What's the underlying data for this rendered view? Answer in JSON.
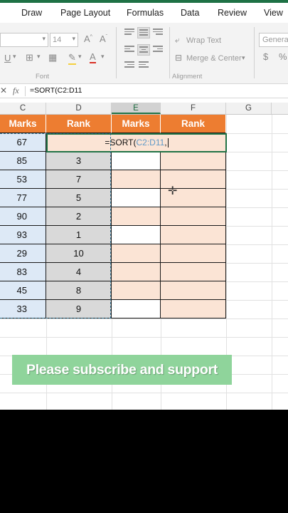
{
  "menu": [
    "Draw",
    "Page Layout",
    "Formulas",
    "Data",
    "Review",
    "View"
  ],
  "ribbon": {
    "font_size": "14",
    "wrap_text": "Wrap Text",
    "merge_center": "Merge & Center",
    "number_format": "General",
    "font_group": "Font",
    "alignment_group": "Alignment",
    "currency_symbol": "$",
    "percent_symbol": "%"
  },
  "formula_bar": {
    "fx": "fx",
    "content": "=SORT(C2:D11"
  },
  "columns": [
    "C",
    "D",
    "E",
    "F",
    "G"
  ],
  "headers": {
    "c": "Marks",
    "d": "Rank",
    "e": "Marks",
    "f": "Rank"
  },
  "rows": [
    {
      "marks": "67",
      "rank": ""
    },
    {
      "marks": "85",
      "rank": "3"
    },
    {
      "marks": "53",
      "rank": "7"
    },
    {
      "marks": "77",
      "rank": "5"
    },
    {
      "marks": "90",
      "rank": "2"
    },
    {
      "marks": "93",
      "rank": "1"
    },
    {
      "marks": "29",
      "rank": "10"
    },
    {
      "marks": "83",
      "rank": "4"
    },
    {
      "marks": "45",
      "rank": "8"
    },
    {
      "marks": "33",
      "rank": "9"
    }
  ],
  "edit_cell": {
    "prefix": "=SORT(",
    "ref": "C2:D11",
    "suffix": ","
  },
  "banner": "Please subscribe and support",
  "colors": {
    "header": "#ed7d31",
    "excel_green": "#217346",
    "peach": "#fbe4d5",
    "banner": "#8fd49b"
  }
}
